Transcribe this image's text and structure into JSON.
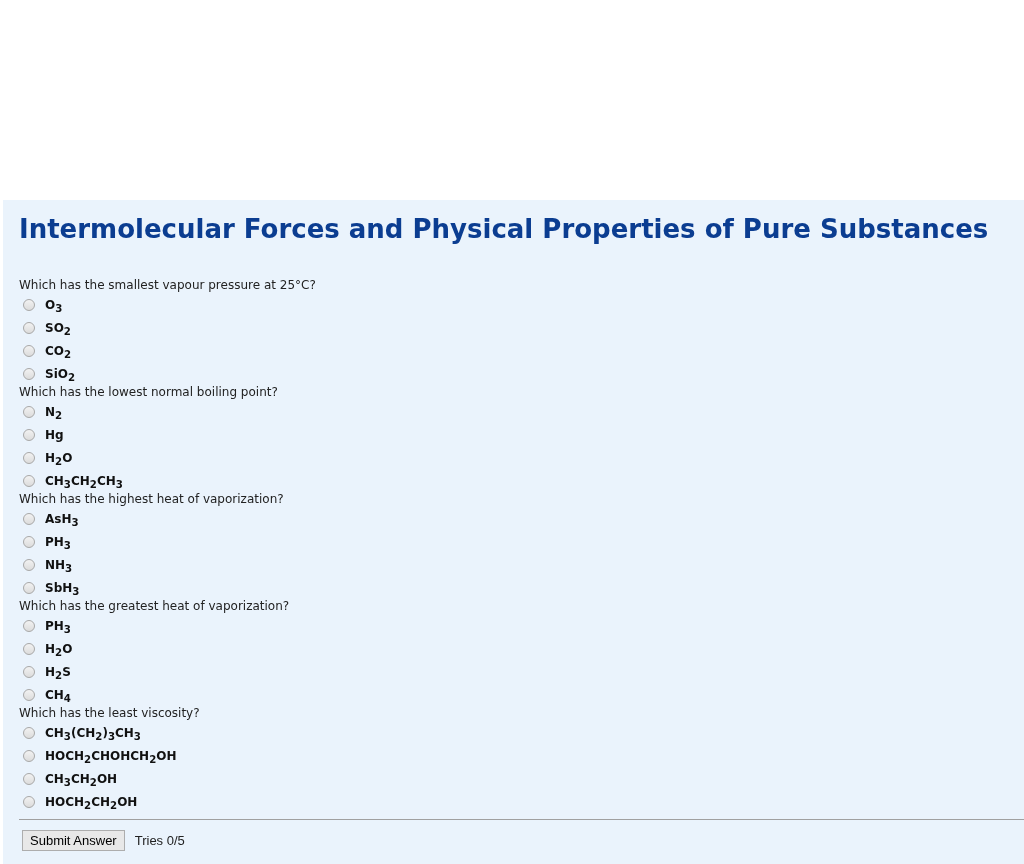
{
  "title": "Intermolecular Forces and Physical Properties of Pure Substances",
  "questions": [
    {
      "prompt": "Which has the smallest vapour pressure at 25°C?",
      "options": [
        {
          "label": "O$_{3}$",
          "selected": false
        },
        {
          "label": "SO$_{2}$",
          "selected": false
        },
        {
          "label": "CO$_{2}$",
          "selected": false
        },
        {
          "label": "SiO$_{2}$",
          "selected": false
        }
      ]
    },
    {
      "prompt": "Which has the lowest normal boiling point?",
      "options": [
        {
          "label": "N$_{2}$",
          "selected": false
        },
        {
          "label": "Hg",
          "selected": false
        },
        {
          "label": "H$_{2}$O",
          "selected": false
        },
        {
          "label": "CH$_{3}$CH$_{2}$CH$_{3}$",
          "selected": false
        }
      ]
    },
    {
      "prompt": "Which has the highest heat of vaporization?",
      "options": [
        {
          "label": "AsH$_{3}$",
          "selected": false
        },
        {
          "label": "PH$_{3}$",
          "selected": false
        },
        {
          "label": "NH$_{3}$",
          "selected": false
        },
        {
          "label": "SbH$_{3}$",
          "selected": false
        }
      ]
    },
    {
      "prompt": "Which has the greatest heat of vaporization?",
      "options": [
        {
          "label": "PH$_{3}$",
          "selected": false
        },
        {
          "label": "H$_{2}$O",
          "selected": false
        },
        {
          "label": "H$_{2}$S",
          "selected": false
        },
        {
          "label": "CH$_{4}$",
          "selected": false
        }
      ]
    },
    {
      "prompt": "Which has the least viscosity?",
      "options": [
        {
          "label": "CH$_{3}$(CH$_{2}$)$_{3}$CH$_{3}$",
          "selected": false
        },
        {
          "label": "HOCH$_{2}$CHOHCH$_{2}$OH",
          "selected": false
        },
        {
          "label": "CH$_{3}$CH$_{2}$OH",
          "selected": false
        },
        {
          "label": "HOCH$_{2}$CH$_{2}$OH",
          "selected": false
        }
      ]
    }
  ],
  "submit": {
    "label": "Submit Answer"
  },
  "tries": "Tries 0/5"
}
